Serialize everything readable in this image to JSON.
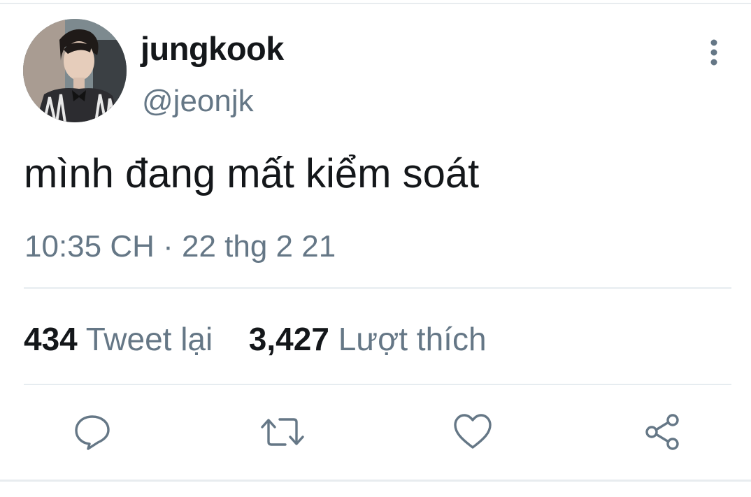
{
  "tweet": {
    "author": {
      "display_name": "jungkook",
      "handle": "@jeonjk"
    },
    "text": "mình đang mất kiểm soát",
    "timestamp": "10:35 CH · 22 thg 2 21",
    "stats": {
      "retweets_count": "434",
      "retweets_label": "Tweet lại",
      "likes_count": "3,427",
      "likes_label": "Lượt thích"
    }
  },
  "icons": {
    "more": "more-vertical-icon",
    "reply": "reply-icon",
    "retweet": "retweet-icon",
    "like": "heart-icon",
    "share": "share-icon"
  },
  "colors": {
    "text": "#14171a",
    "secondary": "#657786",
    "divider": "#e6ecf0"
  }
}
